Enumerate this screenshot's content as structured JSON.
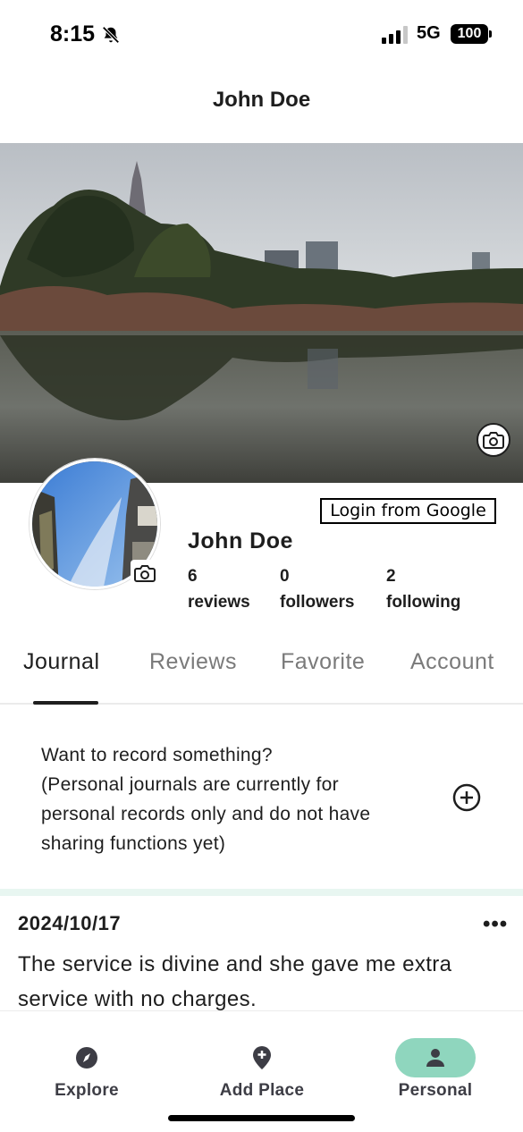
{
  "status_bar": {
    "time": "8:15",
    "network": "5G",
    "battery": "100"
  },
  "header": {
    "title": "John Doe"
  },
  "profile": {
    "login_button": "Login from Google",
    "name": "John Doe",
    "stats": [
      {
        "value": "6",
        "label": "reviews"
      },
      {
        "value": "0",
        "label": "followers"
      },
      {
        "value": "2",
        "label": "following"
      }
    ]
  },
  "tabs": [
    {
      "label": "Journal",
      "active": true
    },
    {
      "label": "Reviews"
    },
    {
      "label": "Favorite"
    },
    {
      "label": "Account"
    }
  ],
  "journal_prompt": {
    "line1": "Want to record something?",
    "line2": "(Personal journals are currently for personal records only and do not have sharing functions yet)"
  },
  "entries": [
    {
      "date": "2024/10/17",
      "more": "•••",
      "text": "The service is divine and she gave me extra service with no charges."
    }
  ],
  "bottom_nav": [
    {
      "label": "Explore",
      "icon": "compass-icon"
    },
    {
      "label": "Add Place",
      "icon": "add-location-icon"
    },
    {
      "label": "Personal",
      "icon": "person-icon",
      "active": true
    }
  ],
  "colors": {
    "accent": "#8fd6be",
    "band": "#e8f6f1",
    "text": "#1e1e1e",
    "muted": "#7a7a7a"
  }
}
